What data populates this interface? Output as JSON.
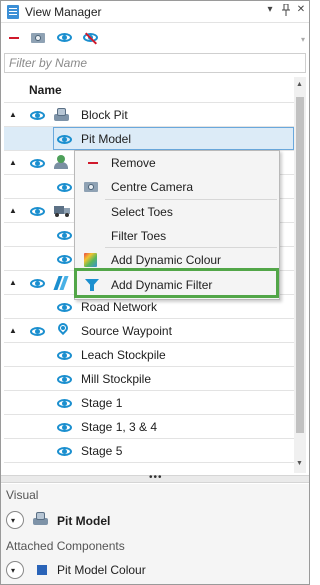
{
  "window": {
    "title": "View Manager",
    "buttons": {
      "menu": "▾",
      "pin": "📌",
      "close": "✕"
    }
  },
  "toolbar": {
    "icons": [
      "minus-icon",
      "camera-icon",
      "eye-icon",
      "eye-off-icon"
    ],
    "overflow": "▾"
  },
  "filter": {
    "placeholder": "Filter by Name",
    "value": ""
  },
  "tree": {
    "column_header": "Name",
    "rows": [
      {
        "label": "Block Pit",
        "level": 0,
        "expander": "▲",
        "icon": "pit-icon"
      },
      {
        "label": "Pit Model",
        "level": 1,
        "selected": true,
        "icon": "eye-icon"
      },
      {
        "label": "",
        "level": 0,
        "expander": "▲",
        "icon": "person-icon"
      },
      {
        "label": "",
        "level": 1,
        "icon": "eye-icon"
      },
      {
        "label": "",
        "level": 0,
        "expander": "▲",
        "icon": "truck-icon"
      },
      {
        "label": "",
        "level": 1,
        "icon": "eye-icon"
      },
      {
        "label": "",
        "level": 1,
        "icon": "eye-icon"
      },
      {
        "label": "",
        "level": 0,
        "expander": "▲",
        "icon": "road-icon"
      },
      {
        "label": "Road Network",
        "level": 1,
        "icon": "eye-icon"
      },
      {
        "label": "Source Waypoint",
        "level": 0,
        "expander": "▲",
        "icon": "pin-icon"
      },
      {
        "label": "Leach Stockpile",
        "level": 1,
        "icon": "eye-icon"
      },
      {
        "label": "Mill Stockpile",
        "level": 1,
        "icon": "eye-icon"
      },
      {
        "label": "Stage 1",
        "level": 1,
        "icon": "eye-icon"
      },
      {
        "label": "Stage 1, 3 & 4",
        "level": 1,
        "icon": "eye-icon"
      },
      {
        "label": "Stage 5",
        "level": 1,
        "icon": "eye-icon"
      }
    ]
  },
  "scrollbar": {
    "up": "▲",
    "down": "▼"
  },
  "splitter": {
    "grip": "•••"
  },
  "context_menu": {
    "items": [
      {
        "label": "Remove",
        "icon": "minus-icon"
      },
      {
        "label": "Centre Camera",
        "icon": "camera-icon"
      },
      {
        "label": "Select Toes",
        "icon": ""
      },
      {
        "label": "Filter Toes",
        "icon": ""
      },
      {
        "label": "Add Dynamic Colour",
        "icon": "colour-icon"
      },
      {
        "label": "Add Dynamic Filter",
        "icon": "filter-icon",
        "highlighted": true
      }
    ],
    "highlight_color": "#52a648"
  },
  "bottom_panel": {
    "visual_label": "Visual",
    "visual_item": "Pit Model",
    "attached_label": "Attached Components",
    "attached_item": "Pit Model Colour",
    "expand_glyph": "▾"
  },
  "colors": {
    "accent_blue": "#1b8fcf",
    "remove_red": "#d0192b",
    "selection": "#dcebf7"
  }
}
